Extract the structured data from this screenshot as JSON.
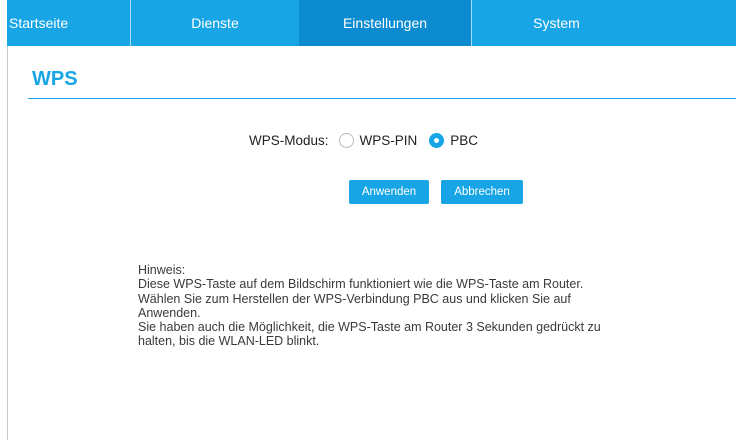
{
  "nav": {
    "tabs": [
      {
        "label": "Startseite"
      },
      {
        "label": "Dienste"
      },
      {
        "label": "Einstellungen"
      },
      {
        "label": "System"
      }
    ],
    "active_color": "#0d8bd1",
    "bar_color": "#17a5e6"
  },
  "page": {
    "title": "WPS"
  },
  "wps": {
    "mode_label": "WPS-Modus:",
    "options": [
      {
        "label": "WPS-PIN",
        "selected": false
      },
      {
        "label": "PBC",
        "selected": true
      }
    ]
  },
  "actions": {
    "apply_label": "Anwenden",
    "cancel_label": "Abbrechen"
  },
  "note": {
    "lines": [
      "Hinweis:",
      "Diese WPS-Taste auf dem Bildschirm funktioniert wie die WPS-Taste am Router.",
      "Wählen Sie zum Herstellen der WPS-Verbindung PBC aus und klicken Sie auf",
      "Anwenden.",
      "Sie haben auch die Möglichkeit, die WPS-Taste am Router 3 Sekunden gedrückt zu",
      "halten, bis die WLAN-LED blinkt."
    ]
  }
}
